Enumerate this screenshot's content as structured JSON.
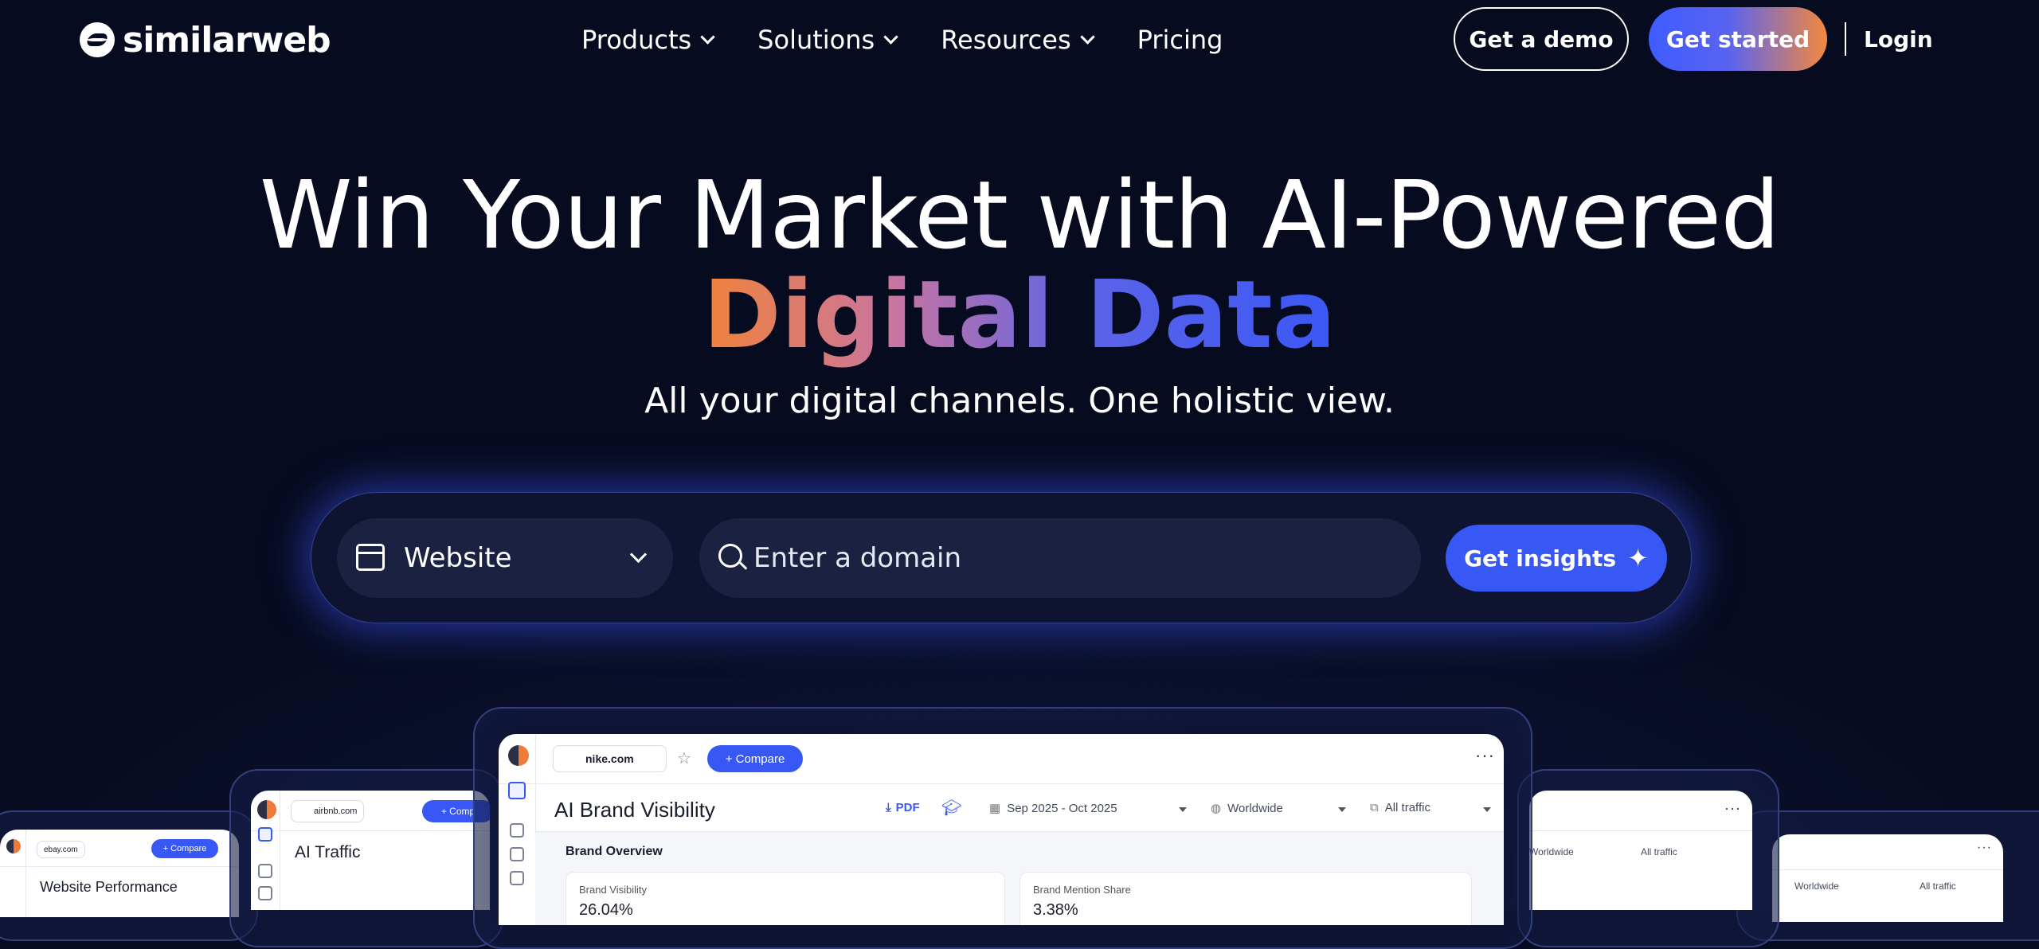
{
  "brand": {
    "name": "similarweb"
  },
  "nav": {
    "items": [
      {
        "label": "Products",
        "has_dropdown": true
      },
      {
        "label": "Solutions",
        "has_dropdown": true
      },
      {
        "label": "Resources",
        "has_dropdown": true
      },
      {
        "label": "Pricing",
        "has_dropdown": false
      }
    ],
    "demo_label": "Get a demo",
    "start_label": "Get started",
    "login_label": "Login"
  },
  "hero": {
    "line1": "Win Your Market with AI-Powered",
    "line2": "Digital Data",
    "subtitle": "All your digital channels. One holistic view."
  },
  "search": {
    "select_value": "Website",
    "placeholder": "Enter a domain",
    "button_label": "Get insights"
  },
  "colors": {
    "background": "#070b1f",
    "accent": "#3858f5",
    "gradient_start": "#f0833a",
    "gradient_end": "#3b58f5"
  },
  "cards": {
    "main": {
      "domain": "nike.com",
      "compare": "+ Compare",
      "title": "AI Brand Visibility",
      "pdf": "PDF",
      "date_range": "Sep 2025 - Oct 2025",
      "region": "Worldwide",
      "traffic": "All traffic",
      "section": "Brand Overview",
      "kpi1_label": "Brand Visibility",
      "kpi1_value": "26.04%",
      "kpi2_label": "Brand Mention Share",
      "kpi2_value": "3.38%"
    },
    "left2": {
      "domain": "airbnb.com",
      "compare": "+ Comp",
      "title": "AI Traffic"
    },
    "left1": {
      "domain": "ebay.com",
      "compare": "+ Compare",
      "title": "Website Performance"
    },
    "right2": {
      "region": "Worldwide",
      "traffic": "All traffic"
    },
    "right1": {
      "region": "Worldwide",
      "traffic": "All traffic"
    }
  }
}
